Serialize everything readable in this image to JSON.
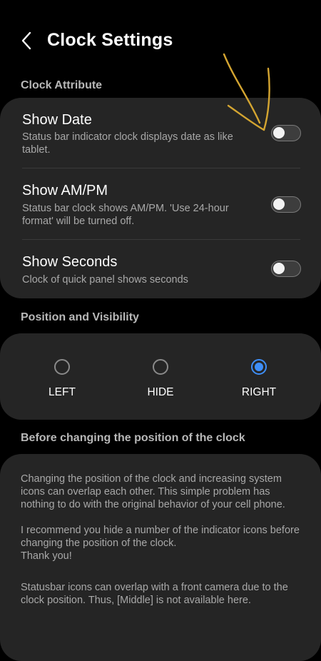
{
  "header": {
    "title": "Clock Settings",
    "back_icon": "chevron-left-icon"
  },
  "clock_attribute": {
    "section_label": "Clock Attribute",
    "rows": [
      {
        "title": "Show Date",
        "subtitle": "Status bar indicator clock displays date as like tablet.",
        "enabled": false
      },
      {
        "title": "Show AM/PM",
        "subtitle": "Status bar clock shows AM/PM. 'Use 24-hour format' will be turned off.",
        "enabled": false
      },
      {
        "title": "Show Seconds",
        "subtitle": "Clock of quick panel shows seconds",
        "enabled": false
      }
    ]
  },
  "position": {
    "section_label": "Position and Visibility",
    "options": [
      {
        "label": "LEFT",
        "selected": false
      },
      {
        "label": "HIDE",
        "selected": false
      },
      {
        "label": "RIGHT",
        "selected": true
      }
    ]
  },
  "notice": {
    "section_label": "Before changing the position of the clock",
    "paragraph1": "Changing the position of the clock and increasing system icons can overlap each other. This simple problem has nothing to do with the original behavior of your cell phone.",
    "paragraph2": " I recommend you hide a number of the indicator icons before changing the position of the clock.",
    "paragraph3": " Thank you!",
    "paragraph4": "Statusbar icons can overlap with a front camera due to the clock position. Thus, [Middle] is not available here."
  },
  "colors": {
    "background": "#000000",
    "card": "#252525",
    "accent": "#3e8ef7",
    "annotation": "#d4a531"
  }
}
